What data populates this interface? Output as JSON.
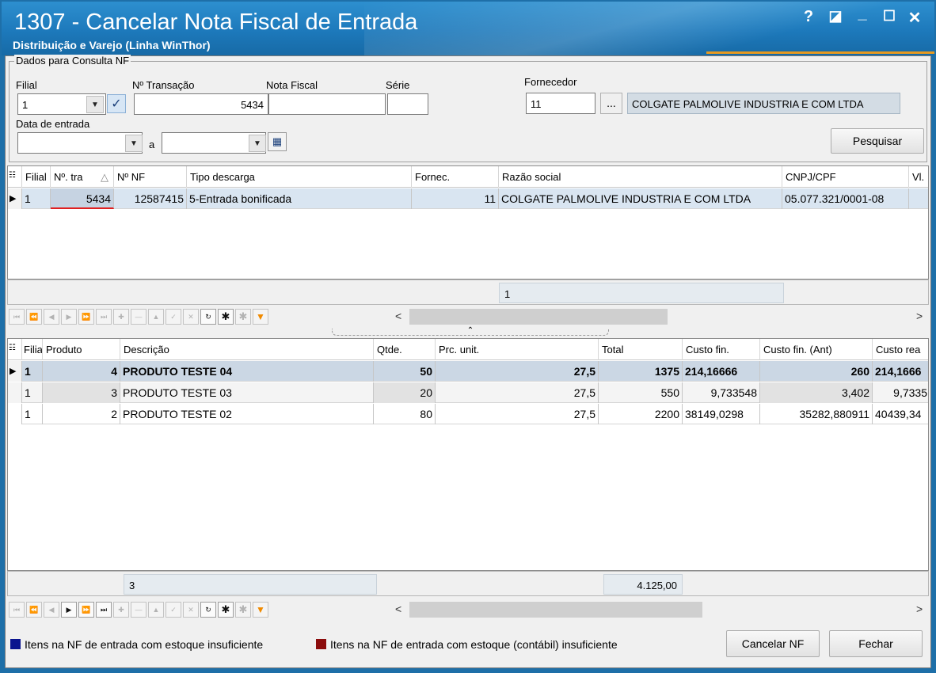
{
  "window": {
    "title": "1307 - Cancelar Nota Fiscal de  Entrada",
    "subtitle": "Distribuição e Varejo (Linha WinThor)",
    "help_glyph": "?",
    "restore_glyph": "◪",
    "minimize_glyph": "_",
    "maximize_glyph": "☐",
    "close_glyph": "✕"
  },
  "filter": {
    "group_label": "Dados para Consulta NF",
    "filial_label": "Filial",
    "filial_value": "1",
    "transacao_label": "Nº Transação",
    "transacao_value": "5434",
    "nota_label": "Nota Fiscal",
    "nota_value": "",
    "serie_label": "Série",
    "serie_value": "",
    "fornecedor_label": "Fornecedor",
    "fornecedor_value": "11",
    "fornecedor_lookup": "...",
    "fornecedor_name": "COLGATE PALMOLIVE INDUSTRIA  E COM LTDA",
    "data_label": "Data de entrada",
    "data_inicio": "",
    "data_sep": "a",
    "data_fim": "",
    "pesquisar": "Pesquisar"
  },
  "nf_grid": {
    "columns": [
      "Filial",
      "Nº. tra",
      "Nº NF",
      "Tipo descarga",
      "Fornec.",
      "Razão social",
      "CNPJ/CPF",
      "Vl."
    ],
    "sort_glyph": "△",
    "rows": [
      {
        "filial": "1",
        "transacao": "5434",
        "nf": "12587415",
        "tipo": "5-Entrada bonificada",
        "fornec": "11",
        "razao": "COLGATE PALMOLIVE INDUSTRIA  E COM LTDA",
        "cnpj": "05.077.321/0001-08"
      }
    ],
    "footer_count": "1"
  },
  "items_grid": {
    "columns": [
      "Filia",
      "Produto",
      "Descrição",
      "Qtde.",
      "Prc. unit.",
      "Total",
      "Custo fin.",
      "Custo fin. (Ant)",
      "Custo rea"
    ],
    "rows": [
      {
        "filial": "1",
        "produto": "4",
        "descricao": "PRODUTO TESTE 04",
        "qtde": "50",
        "prc": "27,5",
        "total": "1375",
        "custo": "214,16666",
        "custo_ant": "260",
        "custo_real": "214,1666"
      },
      {
        "filial": "1",
        "produto": "3",
        "descricao": "PRODUTO TESTE 03",
        "qtde": "20",
        "prc": "27,5",
        "total": "550",
        "custo": "9,733548",
        "custo_ant": "3,402",
        "custo_real": "9,7335"
      },
      {
        "filial": "1",
        "produto": "2",
        "descricao": "PRODUTO TESTE 02",
        "qtde": "80",
        "prc": "27,5",
        "total": "2200",
        "custo": "38149,0298",
        "custo_ant": "35282,880911",
        "custo_real": "40439,34"
      }
    ],
    "footer_count": "3",
    "footer_total": "4.125,00"
  },
  "legend": {
    "item1": "Itens na NF de entrada com estoque insuficiente",
    "item1_color": "#0a148f",
    "item2": "Itens na NF de entrada com estoque (contábil) insuficiente",
    "item2_color": "#8b0c0c"
  },
  "actions": {
    "cancelar": "Cancelar NF",
    "fechar": "Fechar"
  },
  "colors": {
    "title_bar": "#1d79bb",
    "accent_orange": "#e89a20"
  }
}
